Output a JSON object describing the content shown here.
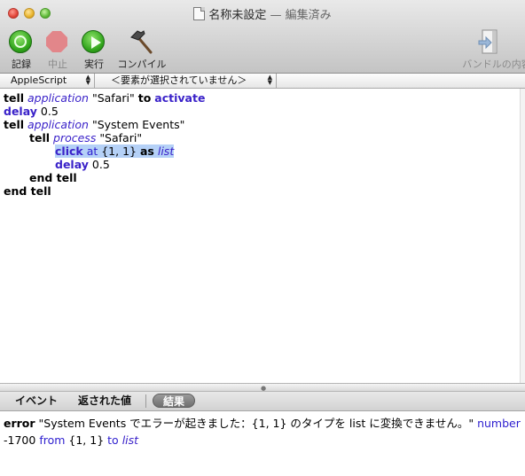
{
  "window": {
    "title": "名称未設定",
    "title_separator": "—",
    "title_status": "編集済み"
  },
  "toolbar": {
    "record_label": "記録",
    "stop_label": "中止",
    "run_label": "実行",
    "compile_label": "コンパイル",
    "bundle_label": "バンドルの内容"
  },
  "navbar": {
    "language": "AppleScript",
    "element": "＜要素が選択されていません＞"
  },
  "script": {
    "l1": {
      "w1": "tell",
      "w2": "application",
      "w3": "\"Safari\"",
      "w4": "to",
      "w5": "activate"
    },
    "l2": {
      "w1": "delay",
      "w2": "0.5"
    },
    "l3": {
      "w1": "tell",
      "w2": "application",
      "w3": "\"System Events\""
    },
    "l4": {
      "w1": "tell",
      "w2": "process",
      "w3": "\"Safari\""
    },
    "l5": {
      "w1": "click",
      "w2": "at",
      "w3": "{1, 1}",
      "w4": "as",
      "w5": "list"
    },
    "l6": {
      "w1": "delay",
      "w2": "0.5"
    },
    "l7": {
      "w1": "end tell"
    },
    "l8": {
      "w1": "end tell"
    }
  },
  "results": {
    "tabs": [
      "イベント",
      "返された値",
      "結果"
    ],
    "selected_tab": "結果",
    "line1": {
      "w1": "error",
      "w2": "\"System Events でエラーが起きました：{1, 1} のタイプを list に変換できません。\"",
      "w3": "number"
    },
    "line2": {
      "w1": "-1700",
      "w2": "from",
      "w3": "{1, 1}",
      "w4": "to",
      "w5": "list"
    }
  },
  "colors": {
    "keyword_blue": "#3a22c9",
    "selection": "#b5d1f7"
  }
}
